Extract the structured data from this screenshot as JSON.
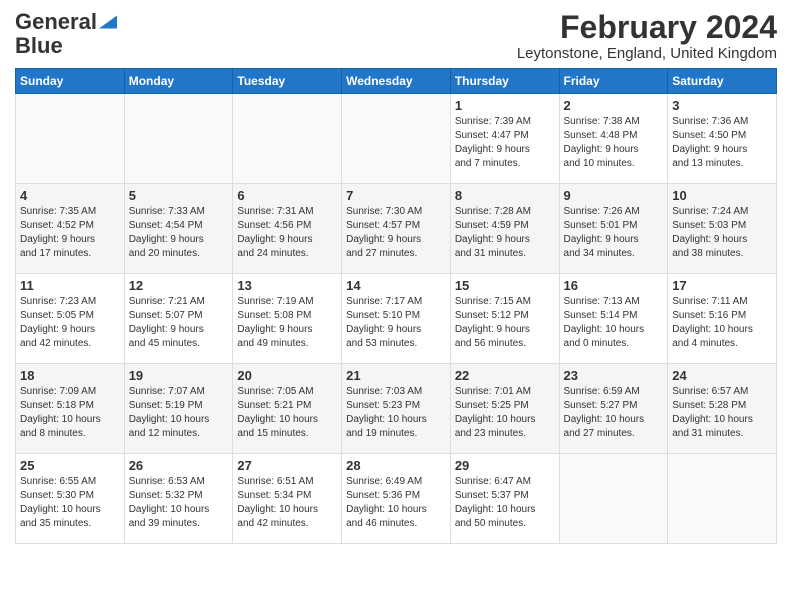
{
  "header": {
    "logo_general": "General",
    "logo_blue": "Blue",
    "month": "February 2024",
    "location": "Leytonstone, England, United Kingdom"
  },
  "days_of_week": [
    "Sunday",
    "Monday",
    "Tuesday",
    "Wednesday",
    "Thursday",
    "Friday",
    "Saturday"
  ],
  "weeks": [
    [
      {
        "day": "",
        "info": ""
      },
      {
        "day": "",
        "info": ""
      },
      {
        "day": "",
        "info": ""
      },
      {
        "day": "",
        "info": ""
      },
      {
        "day": "1",
        "info": "Sunrise: 7:39 AM\nSunset: 4:47 PM\nDaylight: 9 hours\nand 7 minutes."
      },
      {
        "day": "2",
        "info": "Sunrise: 7:38 AM\nSunset: 4:48 PM\nDaylight: 9 hours\nand 10 minutes."
      },
      {
        "day": "3",
        "info": "Sunrise: 7:36 AM\nSunset: 4:50 PM\nDaylight: 9 hours\nand 13 minutes."
      }
    ],
    [
      {
        "day": "4",
        "info": "Sunrise: 7:35 AM\nSunset: 4:52 PM\nDaylight: 9 hours\nand 17 minutes."
      },
      {
        "day": "5",
        "info": "Sunrise: 7:33 AM\nSunset: 4:54 PM\nDaylight: 9 hours\nand 20 minutes."
      },
      {
        "day": "6",
        "info": "Sunrise: 7:31 AM\nSunset: 4:56 PM\nDaylight: 9 hours\nand 24 minutes."
      },
      {
        "day": "7",
        "info": "Sunrise: 7:30 AM\nSunset: 4:57 PM\nDaylight: 9 hours\nand 27 minutes."
      },
      {
        "day": "8",
        "info": "Sunrise: 7:28 AM\nSunset: 4:59 PM\nDaylight: 9 hours\nand 31 minutes."
      },
      {
        "day": "9",
        "info": "Sunrise: 7:26 AM\nSunset: 5:01 PM\nDaylight: 9 hours\nand 34 minutes."
      },
      {
        "day": "10",
        "info": "Sunrise: 7:24 AM\nSunset: 5:03 PM\nDaylight: 9 hours\nand 38 minutes."
      }
    ],
    [
      {
        "day": "11",
        "info": "Sunrise: 7:23 AM\nSunset: 5:05 PM\nDaylight: 9 hours\nand 42 minutes."
      },
      {
        "day": "12",
        "info": "Sunrise: 7:21 AM\nSunset: 5:07 PM\nDaylight: 9 hours\nand 45 minutes."
      },
      {
        "day": "13",
        "info": "Sunrise: 7:19 AM\nSunset: 5:08 PM\nDaylight: 9 hours\nand 49 minutes."
      },
      {
        "day": "14",
        "info": "Sunrise: 7:17 AM\nSunset: 5:10 PM\nDaylight: 9 hours\nand 53 minutes."
      },
      {
        "day": "15",
        "info": "Sunrise: 7:15 AM\nSunset: 5:12 PM\nDaylight: 9 hours\nand 56 minutes."
      },
      {
        "day": "16",
        "info": "Sunrise: 7:13 AM\nSunset: 5:14 PM\nDaylight: 10 hours\nand 0 minutes."
      },
      {
        "day": "17",
        "info": "Sunrise: 7:11 AM\nSunset: 5:16 PM\nDaylight: 10 hours\nand 4 minutes."
      }
    ],
    [
      {
        "day": "18",
        "info": "Sunrise: 7:09 AM\nSunset: 5:18 PM\nDaylight: 10 hours\nand 8 minutes."
      },
      {
        "day": "19",
        "info": "Sunrise: 7:07 AM\nSunset: 5:19 PM\nDaylight: 10 hours\nand 12 minutes."
      },
      {
        "day": "20",
        "info": "Sunrise: 7:05 AM\nSunset: 5:21 PM\nDaylight: 10 hours\nand 15 minutes."
      },
      {
        "day": "21",
        "info": "Sunrise: 7:03 AM\nSunset: 5:23 PM\nDaylight: 10 hours\nand 19 minutes."
      },
      {
        "day": "22",
        "info": "Sunrise: 7:01 AM\nSunset: 5:25 PM\nDaylight: 10 hours\nand 23 minutes."
      },
      {
        "day": "23",
        "info": "Sunrise: 6:59 AM\nSunset: 5:27 PM\nDaylight: 10 hours\nand 27 minutes."
      },
      {
        "day": "24",
        "info": "Sunrise: 6:57 AM\nSunset: 5:28 PM\nDaylight: 10 hours\nand 31 minutes."
      }
    ],
    [
      {
        "day": "25",
        "info": "Sunrise: 6:55 AM\nSunset: 5:30 PM\nDaylight: 10 hours\nand 35 minutes."
      },
      {
        "day": "26",
        "info": "Sunrise: 6:53 AM\nSunset: 5:32 PM\nDaylight: 10 hours\nand 39 minutes."
      },
      {
        "day": "27",
        "info": "Sunrise: 6:51 AM\nSunset: 5:34 PM\nDaylight: 10 hours\nand 42 minutes."
      },
      {
        "day": "28",
        "info": "Sunrise: 6:49 AM\nSunset: 5:36 PM\nDaylight: 10 hours\nand 46 minutes."
      },
      {
        "day": "29",
        "info": "Sunrise: 6:47 AM\nSunset: 5:37 PM\nDaylight: 10 hours\nand 50 minutes."
      },
      {
        "day": "",
        "info": ""
      },
      {
        "day": "",
        "info": ""
      }
    ]
  ]
}
